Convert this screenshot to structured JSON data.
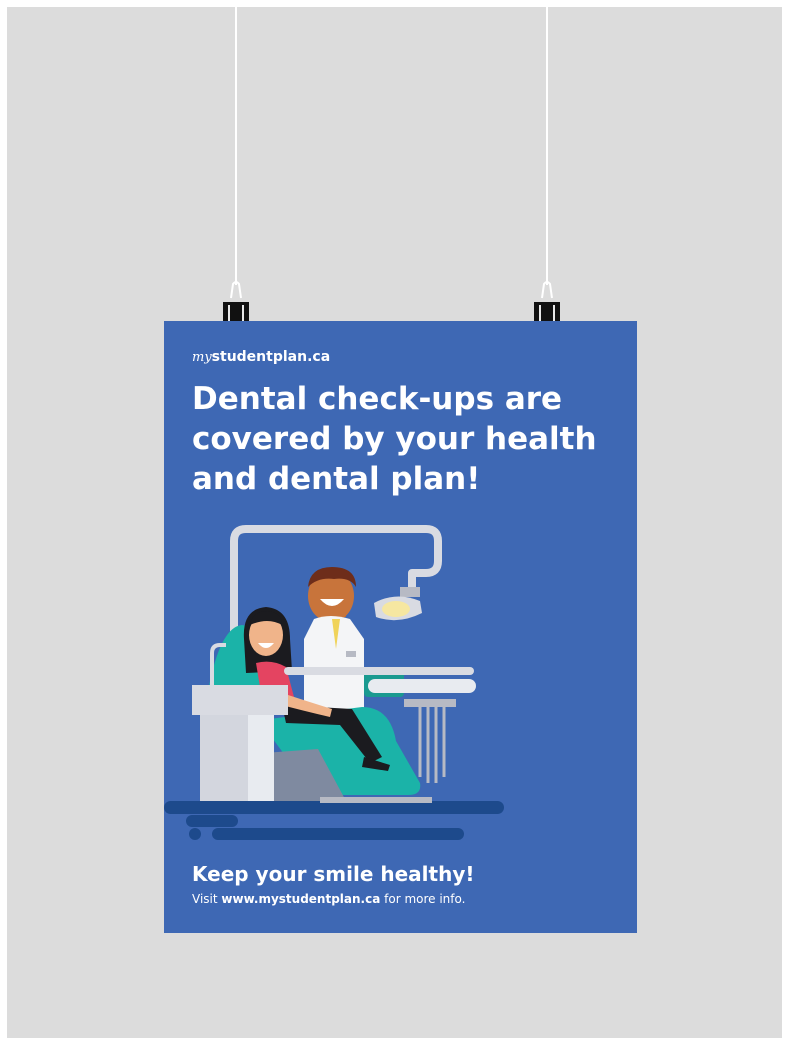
{
  "brand": {
    "prefix": "my",
    "name": "studentplan.ca"
  },
  "poster": {
    "headline": "Dental check-ups are\ncovered by your health\nand dental plan!",
    "tagline": "Keep your smile healthy!",
    "visit_before": "Visit ",
    "visit_url": "www.mystudentplan.ca",
    "visit_after": " for more info."
  },
  "colors": {
    "poster_bg": "#3e68b4",
    "wall_bg": "#dcdcdc",
    "floor": "#1d4a8c",
    "chair_teal": "#1bb3a8",
    "lamp": "#f6e7a1"
  },
  "icons": [
    "binder-clip-icon",
    "dentist-illustration",
    "patient-illustration",
    "dental-chair-illustration",
    "dental-lamp-icon"
  ]
}
